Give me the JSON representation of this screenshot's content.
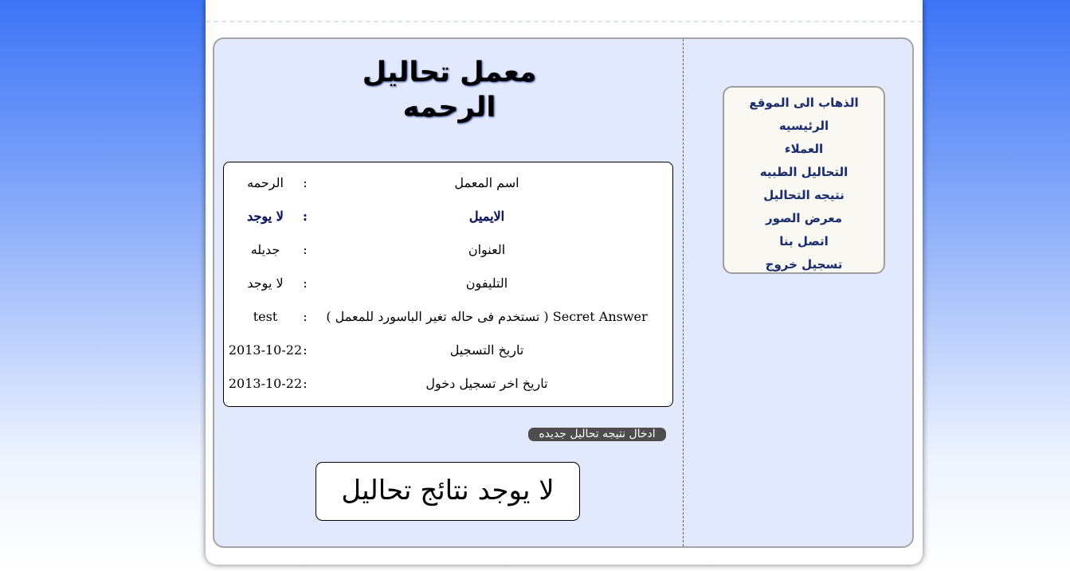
{
  "lab_title": "معمل تحاليل الرحمه",
  "menu": {
    "items": [
      "الذهاب الى الموقع",
      "الرئيسيه",
      "العملاء",
      "التحاليل الطبيه",
      "نتيجه التحاليل",
      "معرض الصور",
      "اتصل بنا",
      "تسجيل خروج"
    ]
  },
  "info": {
    "separator": ":",
    "rows": [
      {
        "label": "اسم المعمل",
        "value": "الرحمه"
      },
      {
        "label": "الايميل",
        "value": "لا يوجد"
      },
      {
        "label": "العنوان",
        "value": "جديله"
      },
      {
        "label": "التليفون",
        "value": "لا يوجد"
      },
      {
        "label": "Secret Answer ( تستخدم فى حاله تغير الباسورد للمعمل )",
        "value": "test"
      },
      {
        "label": "تاريخ التسجيل",
        "value": "2013-10-22"
      },
      {
        "label": "تاريخ اخر تسجيل دخول",
        "value": "2013-10-22"
      }
    ]
  },
  "add_result_button": "ادخال نتيجه تحاليل جديده",
  "no_results_message": "لا يوجد نتائج تحاليل",
  "colors": {
    "panel_background": "#e2e9fd",
    "menu_background": "#f9f8f3",
    "menu_link": "#1c2d6b",
    "button_background": "#4d4d4d",
    "page_gradient_top": "#3d74f6"
  }
}
